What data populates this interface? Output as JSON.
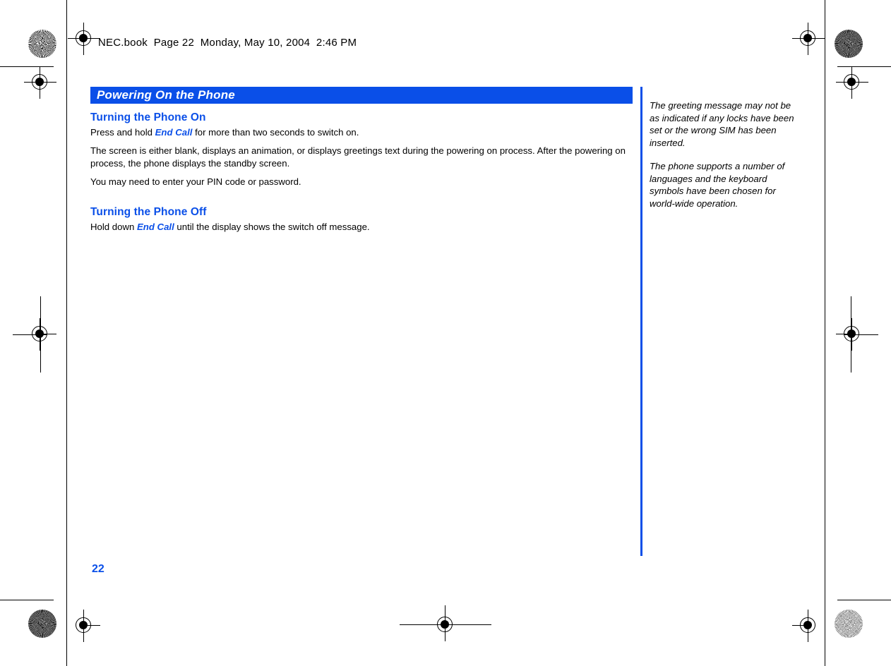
{
  "document": {
    "header_line": "NEC.book  Page 22  Monday, May 10, 2004  2:46 PM",
    "page_number": "22",
    "accent_color": "#0a4fe8",
    "text_color": "#000000",
    "background_color": "#ffffff"
  },
  "banner": {
    "title": "Powering On the Phone"
  },
  "sections": [
    {
      "heading": "Turning the Phone On",
      "paragraphs": [
        {
          "before": "Press and hold ",
          "key": "End Call",
          "after": " for more than two seconds to switch on."
        },
        {
          "before": "The screen is either blank, displays an animation, or displays greetings text during the powering on process. After the powering on process, the phone displays the standby screen.",
          "key": "",
          "after": ""
        },
        {
          "before": "You may need to enter your PIN code or password.",
          "key": "",
          "after": ""
        }
      ]
    },
    {
      "heading": "Turning the Phone Off",
      "paragraphs": [
        {
          "before": "Hold down ",
          "key": "End Call",
          "after": " until the display shows the switch off message."
        }
      ]
    }
  ],
  "margin_notes": [
    "The greeting message may not be as indicated if any locks have been set or the wrong SIM has been inserted.",
    "The phone supports a number of languages and the keyboard symbols have been chosen for world-wide operation."
  ],
  "print_marks": {
    "rosette_label": "registration-rosette",
    "crosshair_label": "registration-crosshair",
    "trim_label": "trim-line"
  }
}
